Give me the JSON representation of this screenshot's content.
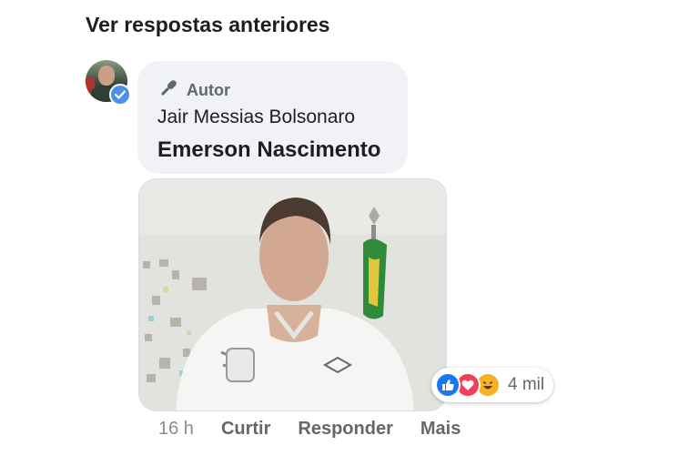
{
  "header": {
    "previous_replies_link": "Ver respostas anteriores"
  },
  "comment": {
    "badge_label": "Autor",
    "author_name": "Jair Messias Bolsonaro",
    "text": "Emerson Nascimento",
    "timestamp": "16 h",
    "actions": {
      "like": "Curtir",
      "reply": "Responder",
      "more": "Mais"
    },
    "reactions": {
      "types": [
        "like-icon",
        "love-icon",
        "haha-icon"
      ],
      "count": "4 mil"
    }
  },
  "colors": {
    "bubble": "#f0f2f5",
    "verified": "#4a90e8",
    "like": "#1877f2",
    "love": "#f33e58",
    "haha": "#f7b125"
  }
}
